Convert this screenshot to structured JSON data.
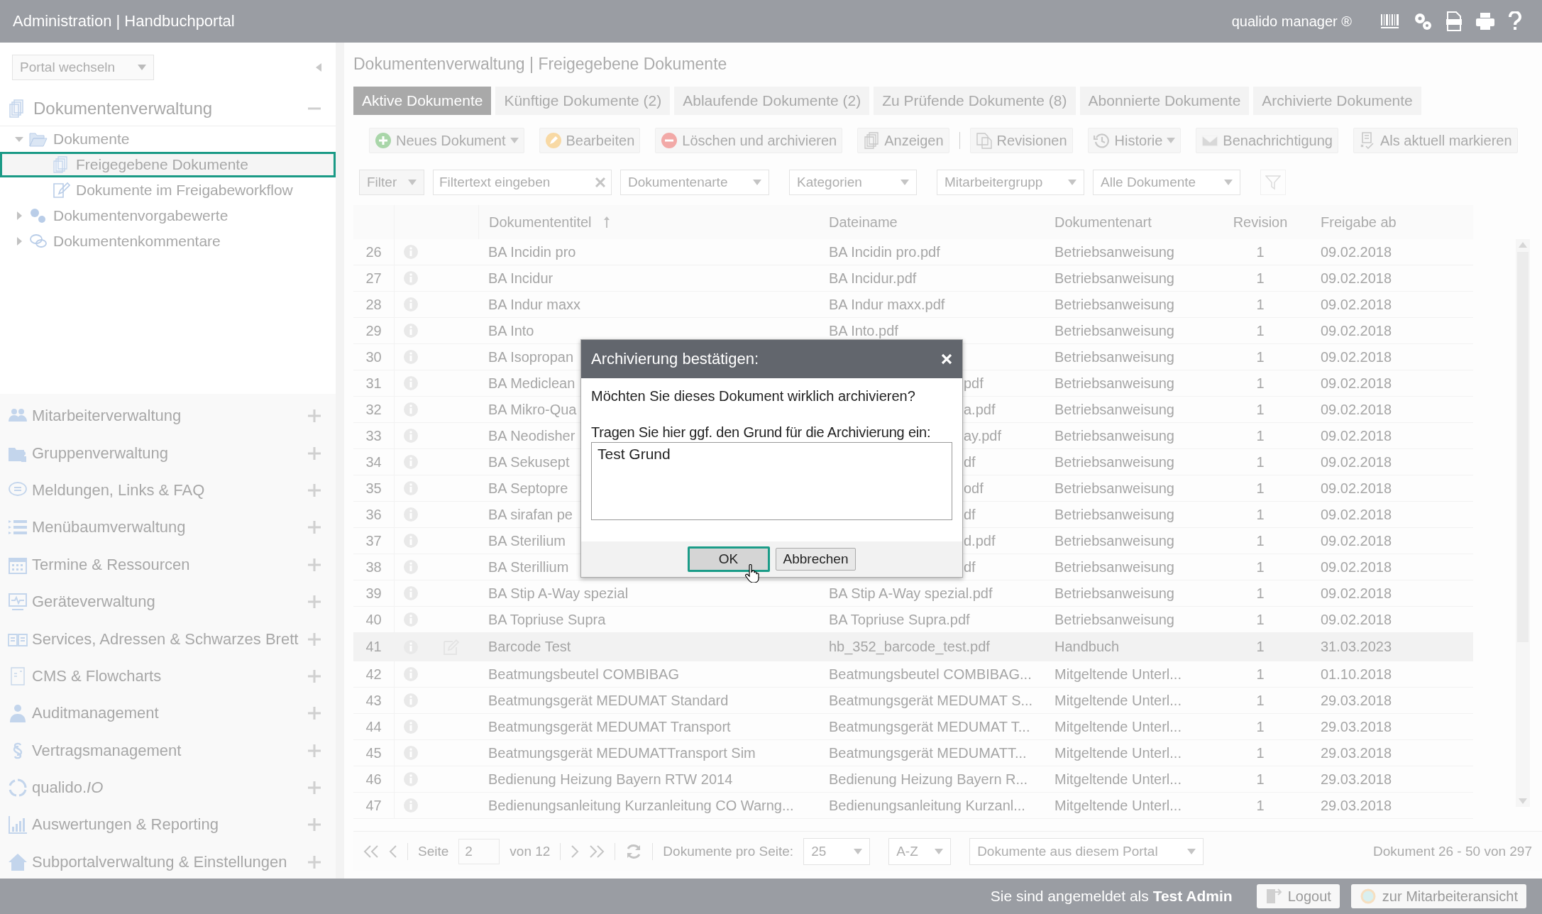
{
  "app_bar": {
    "title": "Administration | Handbuchportal",
    "product": "qualido manager ®"
  },
  "sidebar": {
    "portal_select": "Portal wechseln",
    "section": {
      "label": "Dokumentenverwaltung",
      "expanded": true
    },
    "tree": [
      {
        "label": "Dokumente",
        "expanded": true,
        "selected": false,
        "children": [
          {
            "label": "Freigegebene Dokumente",
            "selected": true
          },
          {
            "label": "Dokumente im Freigabeworkflow",
            "selected": false
          }
        ]
      },
      {
        "label": "Dokumentenvorgabewerte",
        "expanded": false,
        "selected": false
      },
      {
        "label": "Dokumentenkommentare",
        "expanded": false,
        "selected": false
      }
    ],
    "modules": [
      {
        "label": "Mitarbeiterverwaltung",
        "expanded": false
      },
      {
        "label": "Gruppenverwaltung",
        "expanded": false
      },
      {
        "label": "Meldungen, Links & FAQ",
        "expanded": false
      },
      {
        "label": "Menübaumverwaltung",
        "expanded": false
      },
      {
        "label": "Termine & Ressourcen",
        "expanded": false
      },
      {
        "label": "Geräteverwaltung",
        "expanded": false
      },
      {
        "label": "Services, Adressen & Schwarzes Brett",
        "expanded": false
      },
      {
        "label": "CMS & Flowcharts",
        "expanded": false
      },
      {
        "label": "Auditmanagement",
        "expanded": false
      },
      {
        "label": "Vertragsmanagement",
        "expanded": false
      },
      {
        "label": "qualido.*IO*",
        "expanded": false
      },
      {
        "label": "Auswertungen & Reporting",
        "expanded": false
      },
      {
        "label": "Subportalverwaltung & Einstellungen",
        "expanded": false
      }
    ]
  },
  "main": {
    "breadcrumb": "Dokumentenverwaltung | Freigegebene Dokumente",
    "tabs": [
      {
        "label": "Aktive Dokumente",
        "selected": true
      },
      {
        "label": "Künftige Dokumente (2)",
        "selected": false
      },
      {
        "label": "Ablaufende Dokumente (2)",
        "selected": false
      },
      {
        "label": "Zu Prüfende Dokumente (8)",
        "selected": false
      },
      {
        "label": "Abonnierte Dokumente",
        "selected": false
      },
      {
        "label": "Archivierte Dokumente",
        "selected": false
      }
    ],
    "toolbar": [
      {
        "label": "Neues Dokument",
        "dropdown": true
      },
      {
        "label": "Bearbeiten",
        "dropdown": false
      },
      {
        "label": "Löschen und archivieren",
        "dropdown": false
      },
      {
        "label": "Anzeigen",
        "dropdown": false
      },
      {
        "label": "Revisionen",
        "dropdown": false
      },
      {
        "label": "Historie",
        "dropdown": true
      },
      {
        "label": "Benachrichtigung",
        "dropdown": false
      },
      {
        "label": "Als aktuell markieren",
        "dropdown": false
      }
    ],
    "filters": [
      {
        "kind": "dropdown",
        "label": "Filter"
      },
      {
        "kind": "text",
        "placeholder": "Filtertext eingeben"
      },
      {
        "kind": "dropdown",
        "label": "Dokumentenarte"
      },
      {
        "kind": "dropdown",
        "label": "Kategorien"
      },
      {
        "kind": "dropdown",
        "label": "Mitarbeitergrupp"
      },
      {
        "kind": "dropdown",
        "label": "Alle Dokumente"
      }
    ],
    "table": {
      "columns": [
        {
          "label": "Dokumententitel",
          "sorted": true
        },
        {
          "label": "Dateiname",
          "sorted": false
        },
        {
          "label": "Dokumentenart",
          "sorted": false
        },
        {
          "label": "Revision",
          "sorted": false
        },
        {
          "label": "Freigabe ab",
          "sorted": false
        }
      ],
      "rows": [
        {
          "number": "26",
          "title": "BA Incidin pro",
          "file": "BA Incidin pro.pdf",
          "type": "Betriebsanweisung",
          "revision": "1",
          "date": "09.02.2018",
          "selected": false,
          "under_dialog": false
        },
        {
          "number": "27",
          "title": "BA Incidur",
          "file": "BA Incidur.pdf",
          "type": "Betriebsanweisung",
          "revision": "1",
          "date": "09.02.2018",
          "selected": false,
          "under_dialog": false
        },
        {
          "number": "28",
          "title": "BA Indur maxx",
          "file": "BA Indur maxx.pdf",
          "type": "Betriebsanweisung",
          "revision": "1",
          "date": "09.02.2018",
          "selected": false,
          "under_dialog": false
        },
        {
          "number": "29",
          "title": "BA Into",
          "file": "BA Into.pdf",
          "type": "Betriebsanweisung",
          "revision": "1",
          "date": "09.02.2018",
          "selected": false,
          "under_dialog": false
        },
        {
          "number": "30",
          "title": "BA Isopropan",
          "type": "Betriebsanweisung",
          "revision": "1",
          "date": "09.02.2018",
          "selected": false
        },
        {
          "number": "31",
          "title": "BA Mediclean",
          "file": "pdf",
          "type": "Betriebsanweisung",
          "revision": "1",
          "date": "09.02.2018",
          "selected": false,
          "under_dialog": true
        },
        {
          "number": "32",
          "title": "BA Mikro-Qua",
          "file": "a.pdf",
          "type": "Betriebsanweisung",
          "revision": "1",
          "date": "09.02.2018",
          "selected": false,
          "under_dialog": true
        },
        {
          "number": "33",
          "title": "BA Neodisher",
          "file": "ay.pdf",
          "type": "Betriebsanweisung",
          "revision": "1",
          "date": "09.02.2018",
          "selected": false,
          "under_dialog": true
        },
        {
          "number": "34",
          "title": "BA Sekusept",
          "file": "df",
          "type": "Betriebsanweisung",
          "revision": "1",
          "date": "09.02.2018",
          "selected": false,
          "under_dialog": true
        },
        {
          "number": "35",
          "title": "BA Septopre",
          "file": "odf",
          "type": "Betriebsanweisung",
          "revision": "1",
          "date": "09.02.2018",
          "selected": false,
          "under_dialog": true
        },
        {
          "number": "36",
          "title": "BA sirafan pe",
          "file": "df",
          "type": "Betriebsanweisung",
          "revision": "1",
          "date": "09.02.2018",
          "selected": false,
          "under_dialog": true
        },
        {
          "number": "37",
          "title": "BA Sterilium",
          "file": "d.pdf",
          "type": "Betriebsanweisung",
          "revision": "1",
          "date": "09.02.2018",
          "selected": false,
          "under_dialog": true
        },
        {
          "number": "38",
          "title": "BA Sterillium",
          "file": "df",
          "type": "Betriebsanweisung",
          "revision": "1",
          "date": "09.02.2018",
          "selected": false,
          "under_dialog": true
        },
        {
          "number": "39",
          "title": "BA Stip A-Way spezial",
          "file": "BA Stip A-Way spezial.pdf",
          "type": "Betriebsanweisung",
          "revision": "1",
          "date": "09.02.2018",
          "selected": false,
          "under_dialog": false
        },
        {
          "number": "40",
          "title": "BA Topriuse Supra",
          "file": "BA Topriuse Supra.pdf",
          "type": "Betriebsanweisung",
          "revision": "1",
          "date": "09.02.2018",
          "selected": false,
          "under_dialog": false
        },
        {
          "number": "41",
          "title": "Barcode Test",
          "file": "hb_352_barcode_test.pdf",
          "type": "Handbuch",
          "revision": "1",
          "date": "31.03.2023",
          "selected": true,
          "under_dialog": false
        },
        {
          "number": "42",
          "title": "Beatmungsbeutel COMBIBAG",
          "file": "Beatmungsbeutel COMBIBAG...",
          "type": "Mitgeltende Unterl...",
          "revision": "1",
          "date": "01.10.2018",
          "selected": false,
          "under_dialog": false
        },
        {
          "number": "43",
          "title": "Beatmungsgerät MEDUMAT Standard",
          "file": "Beatmungsgerät MEDUMAT S...",
          "type": "Mitgeltende Unterl...",
          "revision": "1",
          "date": "29.03.2018",
          "selected": false,
          "under_dialog": false
        },
        {
          "number": "44",
          "title": "Beatmungsgerät MEDUMAT Transport",
          "file": "Beatmungsgerät MEDUMAT T...",
          "type": "Mitgeltende Unterl...",
          "revision": "1",
          "date": "29.03.2018",
          "selected": false,
          "under_dialog": false
        },
        {
          "number": "45",
          "title": "Beatmungsgerät MEDUMATTransport Sim",
          "file": "Beatmungsgerät MEDUMATT...",
          "type": "Mitgeltende Unterl...",
          "revision": "1",
          "date": "29.03.2018",
          "selected": false,
          "under_dialog": false
        },
        {
          "number": "46",
          "title": "Bedienung Heizung Bayern RTW 2014",
          "file": "Bedienung Heizung Bayern R...",
          "type": "Mitgeltende Unterl...",
          "revision": "1",
          "date": "29.03.2018",
          "selected": false,
          "under_dialog": false
        },
        {
          "number": "47",
          "title": "Bedienungsanleitung Kurzanleitung CO Warng...",
          "file": "Bedienungsanleitung Kurzanl...",
          "type": "Mitgeltende Unterl...",
          "revision": "1",
          "date": "29.03.2018",
          "selected": false,
          "under_dialog": false
        }
      ]
    },
    "pager": {
      "page_label": "Seite",
      "page": "2",
      "of": "von 12",
      "per_page_label": "Dokumente pro Seite:",
      "per_page": "25",
      "sort": "A-Z",
      "scope": "Dokumente aus diesem Portal",
      "summary": "Dokument 26 - 50 von 297"
    }
  },
  "status_bar": {
    "login": "Sie sind angemeldet als **Test Admin**",
    "buttons": [
      {
        "label": "Logout"
      },
      {
        "label": "zur Mitarbeiteransicht"
      }
    ]
  },
  "dialog": {
    "title": "Archivierung bestätigen:",
    "message": "Möchten Sie dieses Dokument wirklich archivieren?",
    "reason_label": "Tragen Sie hier ggf. den Grund für die Archivierung ein:",
    "reason_value": "Test Grund",
    "buttons": [
      {
        "label": "OK",
        "focused": true
      },
      {
        "label": "Abbrechen",
        "focused": false
      }
    ]
  }
}
